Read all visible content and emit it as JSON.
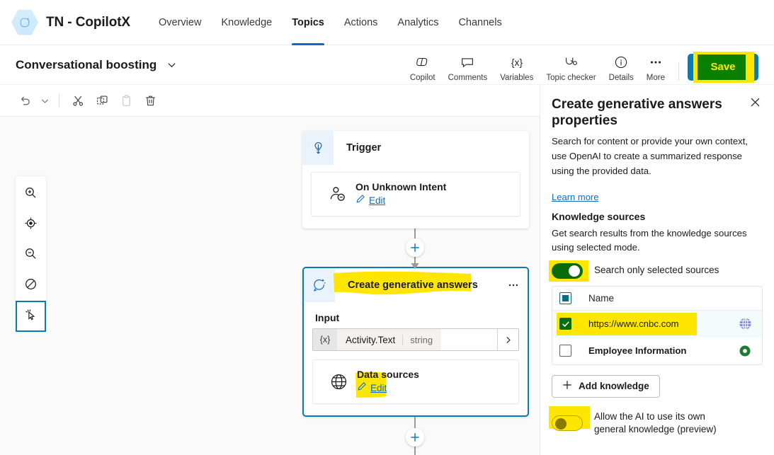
{
  "topnav": {
    "logo_icon": "copilot-hexagon-icon",
    "app_title": "TN - CopilotX",
    "items": [
      {
        "label": "Overview",
        "active": false
      },
      {
        "label": "Knowledge",
        "active": false
      },
      {
        "label": "Topics",
        "active": true
      },
      {
        "label": "Actions",
        "active": false
      },
      {
        "label": "Analytics",
        "active": false
      },
      {
        "label": "Channels",
        "active": false
      }
    ]
  },
  "commandbar": {
    "topic_name": "Conversational boosting",
    "chevron_icon": "chevron-down-icon",
    "tools": [
      {
        "label": "Copilot",
        "icon": "copilot-icon"
      },
      {
        "label": "Comments",
        "icon": "comment-icon"
      },
      {
        "label": "Variables",
        "icon": "variables-icon"
      },
      {
        "label": "Topic checker",
        "icon": "topic-checker-icon"
      },
      {
        "label": "Details",
        "icon": "info-icon"
      },
      {
        "label": "More",
        "icon": "more-ellipsis-icon"
      }
    ],
    "save_label": "Save",
    "save_button_color": "#0b7cb0",
    "save_highlight_color": "#ffe600",
    "save_overlay_color": "#0a8000",
    "save_text_color": "#ffe600"
  },
  "edit_toolbar": {
    "buttons": [
      {
        "name": "undo",
        "icon": "undo-icon",
        "disabled": false
      },
      {
        "name": "undo-more",
        "icon": "chevron-down-icon",
        "disabled": false
      },
      {
        "name": "cut",
        "icon": "scissors-icon",
        "disabled": false
      },
      {
        "name": "copy",
        "icon": "copy-icon",
        "disabled": false
      },
      {
        "name": "paste",
        "icon": "clipboard-paste-icon",
        "disabled": true
      },
      {
        "name": "delete",
        "icon": "trash-icon",
        "disabled": false
      }
    ]
  },
  "canvas": {
    "zoom_tools": [
      {
        "name": "zoom-in",
        "icon": "magnifier-plus-icon",
        "selected": false
      },
      {
        "name": "fit-to-view",
        "icon": "target-icon",
        "selected": false
      },
      {
        "name": "zoom-out",
        "icon": "magnifier-minus-icon",
        "selected": false
      },
      {
        "name": "reset-zoom",
        "icon": "no-zoom-icon",
        "selected": false
      },
      {
        "name": "pointer-tool",
        "icon": "cursor-pointer-icon",
        "selected": true
      }
    ],
    "trigger_node": {
      "icon": "trigger-icon",
      "title": "Trigger",
      "sub_icon": "unknown-intent-person-icon",
      "sub_title": "On Unknown Intent",
      "edit_label": "Edit",
      "edit_icon": "pencil-icon"
    },
    "answers_node": {
      "icon": "generative-answers-icon",
      "title": "Create generative answers",
      "title_highlighted": true,
      "ellipsis_icon": "more-ellipsis-icon",
      "input_label": "Input",
      "input_var_token": "{x}",
      "input_value": "Activity.Text",
      "input_type": "string",
      "input_chevron_icon": "chevron-right-icon",
      "datasource_icon": "globe-icon",
      "datasource_title": "Data sources",
      "datasource_edit_label": "Edit",
      "datasource_edit_icon": "pencil-icon",
      "selected": true
    },
    "plus_icon": "plus-icon",
    "connector_color": "#9a9a9a",
    "plus_color": "#0b7cb0"
  },
  "right_panel": {
    "title": "Create generative answers properties",
    "close_icon": "close-icon",
    "description": "Search for content or provide your own context, use OpenAI to create a summarized response using the provided data.",
    "learn_more": "Learn more",
    "section_title": "Knowledge sources",
    "section_sub": "Get search results from the knowledge sources using selected mode.",
    "search_toggle": {
      "label": "Search only selected sources",
      "state": "on",
      "highlighted": true,
      "color": "#0a6b0a"
    },
    "table": {
      "header": {
        "checkbox_state": "indeterminate",
        "name_label": "Name"
      },
      "rows": [
        {
          "name": "https://www.cnbc.com",
          "checkbox_state": "checked",
          "icon": "globe-website-icon",
          "highlighted": true,
          "selected": true
        },
        {
          "name": "Employee Information",
          "checkbox_state": "unchecked",
          "icon": "dataverse-icon",
          "highlighted": false,
          "selected": false
        }
      ]
    },
    "add_knowledge_label": "Add knowledge",
    "add_knowledge_icon": "plus-icon",
    "general_knowledge_toggle": {
      "line1": "Allow the AI to use its own",
      "line2": "general knowledge (preview)",
      "state": "off",
      "highlighted": true
    }
  },
  "highlight_color": "#ffe600"
}
